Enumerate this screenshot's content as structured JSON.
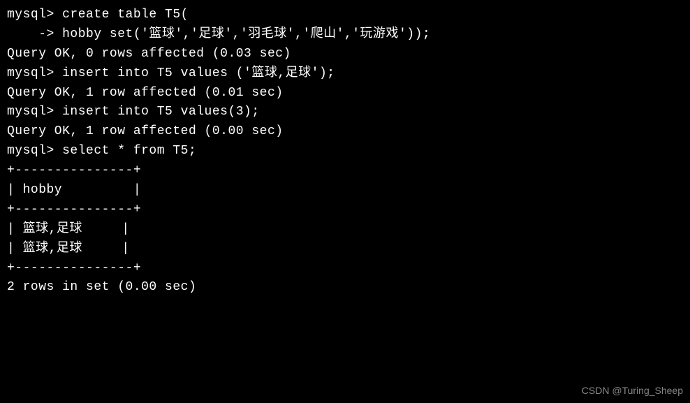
{
  "terminal": {
    "lines": [
      "mysql> create table T5(",
      "    -> hobby set('篮球','足球','羽毛球','爬山','玩游戏'));",
      "Query OK, 0 rows affected (0.03 sec)",
      "",
      "mysql> insert into T5 values ('篮球,足球');",
      "Query OK, 1 row affected (0.01 sec)",
      "",
      "mysql> insert into T5 values(3);",
      "Query OK, 1 row affected (0.00 sec)",
      "",
      "mysql> select * from T5;",
      "+---------------+",
      "| hobby         |",
      "+---------------+",
      "| 篮球,足球     |",
      "| 篮球,足球     |",
      "+---------------+",
      "2 rows in set (0.00 sec)"
    ]
  },
  "watermark": "CSDN @Turing_Sheep"
}
